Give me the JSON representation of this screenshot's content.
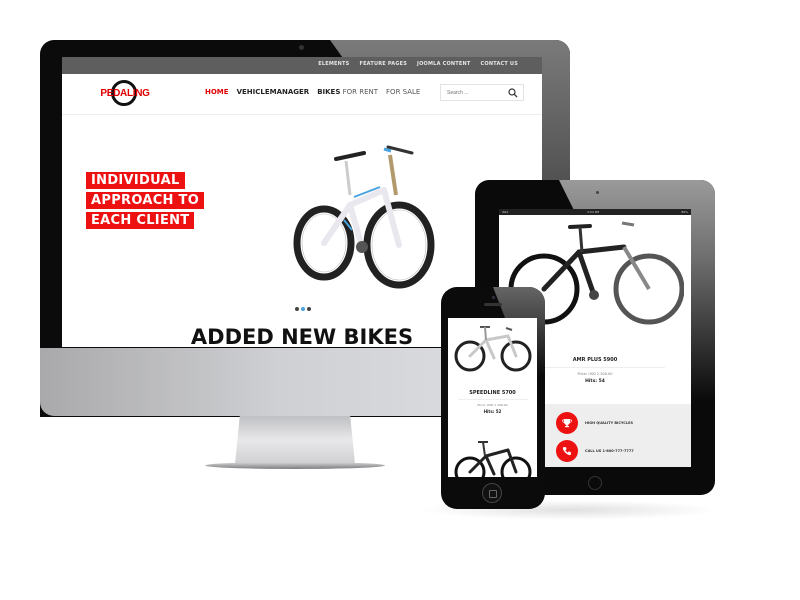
{
  "desktop": {
    "top_links": [
      "ELEMENTS",
      "FEATURE PAGES",
      "JOOMLA CONTENT",
      "CONTACT US"
    ],
    "logo_text": "PEDALING",
    "nav": {
      "home": "HOME",
      "vehiclemanager": "VEHICLEMANAGER",
      "bikes_strong": "BIKES",
      "bikes_rest": " FOR RENT",
      "for_sale": "FOR SALE"
    },
    "search_placeholder": "Search ...",
    "hero_lines": [
      "INDIVIDUAL",
      "APPROACH TO",
      "EACH CLIENT"
    ],
    "slider_dots": 3,
    "slider_active_index": 1,
    "section_title": "ADDED NEW BIKES"
  },
  "tablet": {
    "status": {
      "left": "iPad",
      "center": "3:04 PM",
      "right": "89%"
    },
    "product": {
      "name": "AMR PLUS 5900",
      "price": "Price: USD 2 300.00",
      "hits": "Hits: 54"
    },
    "features": [
      {
        "icon": "trophy-icon",
        "label": "HIGH QUALITY BICYCLES"
      },
      {
        "icon": "phone-icon",
        "label": "CALL US 1-800-777-7777"
      }
    ]
  },
  "phone": {
    "product": {
      "name": "SPEEDLINE 5700",
      "price": "Price: USD 1 199.00",
      "hits": "Hits: 52"
    }
  },
  "colors": {
    "accent": "#ee1111",
    "topbar": "#5e5e5e",
    "slider_active": "#4aa3df"
  }
}
